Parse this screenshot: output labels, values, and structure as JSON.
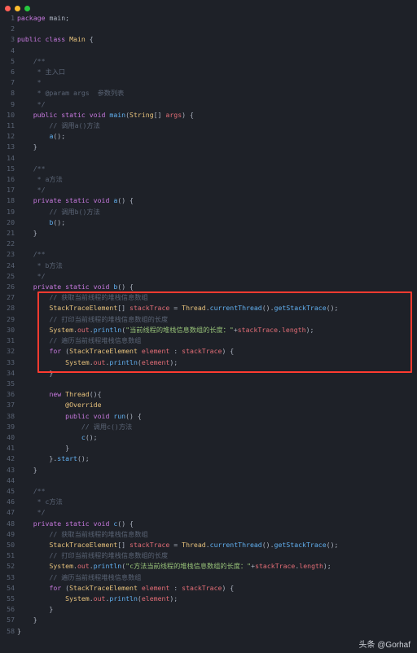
{
  "watermark": "头条 @Gorhaf",
  "lines": [
    {
      "n": 1,
      "tokens": [
        [
          "kw",
          "package"
        ],
        [
          "op",
          " main;"
        ]
      ]
    },
    {
      "n": 2,
      "tokens": []
    },
    {
      "n": 3,
      "tokens": [
        [
          "kw",
          "public class"
        ],
        [
          "op",
          " "
        ],
        [
          "type",
          "Main"
        ],
        [
          "op",
          " {"
        ]
      ]
    },
    {
      "n": 4,
      "tokens": []
    },
    {
      "n": 5,
      "tokens": [
        [
          "op",
          "    "
        ],
        [
          "cmt",
          "/**"
        ]
      ]
    },
    {
      "n": 6,
      "tokens": [
        [
          "op",
          "    "
        ],
        [
          "cmt",
          " * 主入口"
        ]
      ]
    },
    {
      "n": 7,
      "tokens": [
        [
          "op",
          "    "
        ],
        [
          "cmt",
          " *"
        ]
      ]
    },
    {
      "n": 8,
      "tokens": [
        [
          "op",
          "    "
        ],
        [
          "cmt",
          " * @param args  参数列表"
        ]
      ]
    },
    {
      "n": 9,
      "tokens": [
        [
          "op",
          "    "
        ],
        [
          "cmt",
          " */"
        ]
      ]
    },
    {
      "n": 10,
      "tokens": [
        [
          "op",
          "    "
        ],
        [
          "kw",
          "public static void"
        ],
        [
          "op",
          " "
        ],
        [
          "fn",
          "main"
        ],
        [
          "op",
          "("
        ],
        [
          "type",
          "String"
        ],
        [
          "op",
          "[] "
        ],
        [
          "id",
          "args"
        ],
        [
          "op",
          ") {"
        ]
      ]
    },
    {
      "n": 11,
      "tokens": [
        [
          "op",
          "        "
        ],
        [
          "cmt",
          "// 调用a()方法"
        ]
      ]
    },
    {
      "n": 12,
      "tokens": [
        [
          "op",
          "        "
        ],
        [
          "fn",
          "a"
        ],
        [
          "op",
          "();"
        ]
      ]
    },
    {
      "n": 13,
      "tokens": [
        [
          "op",
          "    }"
        ]
      ]
    },
    {
      "n": 14,
      "tokens": []
    },
    {
      "n": 15,
      "tokens": [
        [
          "op",
          "    "
        ],
        [
          "cmt",
          "/**"
        ]
      ]
    },
    {
      "n": 16,
      "tokens": [
        [
          "op",
          "    "
        ],
        [
          "cmt",
          " * a方法"
        ]
      ]
    },
    {
      "n": 17,
      "tokens": [
        [
          "op",
          "    "
        ],
        [
          "cmt",
          " */"
        ]
      ]
    },
    {
      "n": 18,
      "tokens": [
        [
          "op",
          "    "
        ],
        [
          "kw",
          "private static void"
        ],
        [
          "op",
          " "
        ],
        [
          "fn",
          "a"
        ],
        [
          "op",
          "() {"
        ]
      ]
    },
    {
      "n": 19,
      "tokens": [
        [
          "op",
          "        "
        ],
        [
          "cmt",
          "// 调用b()方法"
        ]
      ]
    },
    {
      "n": 20,
      "tokens": [
        [
          "op",
          "        "
        ],
        [
          "fn",
          "b"
        ],
        [
          "op",
          "();"
        ]
      ]
    },
    {
      "n": 21,
      "tokens": [
        [
          "op",
          "    }"
        ]
      ]
    },
    {
      "n": 22,
      "tokens": []
    },
    {
      "n": 23,
      "tokens": [
        [
          "op",
          "    "
        ],
        [
          "cmt",
          "/**"
        ]
      ]
    },
    {
      "n": 24,
      "tokens": [
        [
          "op",
          "    "
        ],
        [
          "cmt",
          " * b方法"
        ]
      ]
    },
    {
      "n": 25,
      "tokens": [
        [
          "op",
          "    "
        ],
        [
          "cmt",
          " */"
        ]
      ]
    },
    {
      "n": 26,
      "tokens": [
        [
          "op",
          "    "
        ],
        [
          "kw",
          "private static void"
        ],
        [
          "op",
          " "
        ],
        [
          "fn",
          "b"
        ],
        [
          "op",
          "() {"
        ]
      ]
    },
    {
      "n": 27,
      "tokens": [
        [
          "op",
          "        "
        ],
        [
          "cmt",
          "// 获取当前线程的堆栈信息数组"
        ]
      ]
    },
    {
      "n": 28,
      "tokens": [
        [
          "op",
          "        "
        ],
        [
          "type",
          "StackTraceElement"
        ],
        [
          "op",
          "[] "
        ],
        [
          "id",
          "stackTrace"
        ],
        [
          "op",
          " = "
        ],
        [
          "type",
          "Thread"
        ],
        [
          "op",
          "."
        ],
        [
          "fn",
          "currentThread"
        ],
        [
          "op",
          "()."
        ],
        [
          "fn",
          "getStackTrace"
        ],
        [
          "op",
          "();"
        ]
      ]
    },
    {
      "n": 29,
      "tokens": [
        [
          "op",
          "        "
        ],
        [
          "cmt",
          "// 打印当前线程的堆栈信息数组的长度"
        ]
      ]
    },
    {
      "n": 30,
      "tokens": [
        [
          "op",
          "        "
        ],
        [
          "type",
          "System"
        ],
        [
          "op",
          "."
        ],
        [
          "id",
          "out"
        ],
        [
          "op",
          "."
        ],
        [
          "fn",
          "println"
        ],
        [
          "op",
          "("
        ],
        [
          "str",
          "\"当前线程的堆栈信息数组的长度：\""
        ],
        [
          "op",
          "+"
        ],
        [
          "id",
          "stackTrace"
        ],
        [
          "op",
          "."
        ],
        [
          "id",
          "length"
        ],
        [
          "op",
          ");"
        ]
      ]
    },
    {
      "n": 31,
      "tokens": [
        [
          "op",
          "        "
        ],
        [
          "cmt",
          "// 遍历当前线程堆栈信息数组"
        ]
      ]
    },
    {
      "n": 32,
      "tokens": [
        [
          "op",
          "        "
        ],
        [
          "kw",
          "for"
        ],
        [
          "op",
          " ("
        ],
        [
          "type",
          "StackTraceElement"
        ],
        [
          "op",
          " "
        ],
        [
          "id",
          "element"
        ],
        [
          "op",
          " : "
        ],
        [
          "id",
          "stackTrace"
        ],
        [
          "op",
          ") {"
        ]
      ]
    },
    {
      "n": 33,
      "tokens": [
        [
          "op",
          "            "
        ],
        [
          "type",
          "System"
        ],
        [
          "op",
          "."
        ],
        [
          "id",
          "out"
        ],
        [
          "op",
          "."
        ],
        [
          "fn",
          "println"
        ],
        [
          "op",
          "("
        ],
        [
          "id",
          "element"
        ],
        [
          "op",
          ");"
        ]
      ]
    },
    {
      "n": 34,
      "tokens": [
        [
          "op",
          "        }"
        ]
      ]
    },
    {
      "n": 35,
      "tokens": []
    },
    {
      "n": 36,
      "tokens": [
        [
          "op",
          "        "
        ],
        [
          "kw",
          "new"
        ],
        [
          "op",
          " "
        ],
        [
          "type",
          "Thread"
        ],
        [
          "op",
          "(){"
        ]
      ]
    },
    {
      "n": 37,
      "tokens": [
        [
          "op",
          "            "
        ],
        [
          "ann",
          "@Override"
        ]
      ]
    },
    {
      "n": 38,
      "tokens": [
        [
          "op",
          "            "
        ],
        [
          "kw",
          "public void"
        ],
        [
          "op",
          " "
        ],
        [
          "fn",
          "run"
        ],
        [
          "op",
          "() {"
        ]
      ]
    },
    {
      "n": 39,
      "tokens": [
        [
          "op",
          "                "
        ],
        [
          "cmt",
          "// 调用c()方法"
        ]
      ]
    },
    {
      "n": 40,
      "tokens": [
        [
          "op",
          "                "
        ],
        [
          "fn",
          "c"
        ],
        [
          "op",
          "();"
        ]
      ]
    },
    {
      "n": 41,
      "tokens": [
        [
          "op",
          "            }"
        ]
      ]
    },
    {
      "n": 42,
      "tokens": [
        [
          "op",
          "        }."
        ],
        [
          "fn",
          "start"
        ],
        [
          "op",
          "();"
        ]
      ]
    },
    {
      "n": 43,
      "tokens": [
        [
          "op",
          "    }"
        ]
      ]
    },
    {
      "n": 44,
      "tokens": []
    },
    {
      "n": 45,
      "tokens": [
        [
          "op",
          "    "
        ],
        [
          "cmt",
          "/**"
        ]
      ]
    },
    {
      "n": 46,
      "tokens": [
        [
          "op",
          "    "
        ],
        [
          "cmt",
          " * c方法"
        ]
      ]
    },
    {
      "n": 47,
      "tokens": [
        [
          "op",
          "    "
        ],
        [
          "cmt",
          " */"
        ]
      ]
    },
    {
      "n": 48,
      "tokens": [
        [
          "op",
          "    "
        ],
        [
          "kw",
          "private static void"
        ],
        [
          "op",
          " "
        ],
        [
          "fn",
          "c"
        ],
        [
          "op",
          "() {"
        ]
      ]
    },
    {
      "n": 49,
      "tokens": [
        [
          "op",
          "        "
        ],
        [
          "cmt",
          "// 获取当前线程的堆栈信息数组"
        ]
      ]
    },
    {
      "n": 50,
      "tokens": [
        [
          "op",
          "        "
        ],
        [
          "type",
          "StackTraceElement"
        ],
        [
          "op",
          "[] "
        ],
        [
          "id",
          "stackTrace"
        ],
        [
          "op",
          " = "
        ],
        [
          "type",
          "Thread"
        ],
        [
          "op",
          "."
        ],
        [
          "fn",
          "currentThread"
        ],
        [
          "op",
          "()."
        ],
        [
          "fn",
          "getStackTrace"
        ],
        [
          "op",
          "();"
        ]
      ]
    },
    {
      "n": 51,
      "tokens": [
        [
          "op",
          "        "
        ],
        [
          "cmt",
          "// 打印当前线程的堆栈信息数组的长度"
        ]
      ]
    },
    {
      "n": 52,
      "tokens": [
        [
          "op",
          "        "
        ],
        [
          "type",
          "System"
        ],
        [
          "op",
          "."
        ],
        [
          "id",
          "out"
        ],
        [
          "op",
          "."
        ],
        [
          "fn",
          "println"
        ],
        [
          "op",
          "("
        ],
        [
          "str",
          "\"c方法当前线程的堆栈信息数组的长度：\""
        ],
        [
          "op",
          "+"
        ],
        [
          "id",
          "stackTrace"
        ],
        [
          "op",
          "."
        ],
        [
          "id",
          "length"
        ],
        [
          "op",
          ");"
        ]
      ]
    },
    {
      "n": 53,
      "tokens": [
        [
          "op",
          "        "
        ],
        [
          "cmt",
          "// 遍历当前线程堆栈信息数组"
        ]
      ]
    },
    {
      "n": 54,
      "tokens": [
        [
          "op",
          "        "
        ],
        [
          "kw",
          "for"
        ],
        [
          "op",
          " ("
        ],
        [
          "type",
          "StackTraceElement"
        ],
        [
          "op",
          " "
        ],
        [
          "id",
          "element"
        ],
        [
          "op",
          " : "
        ],
        [
          "id",
          "stackTrace"
        ],
        [
          "op",
          ") {"
        ]
      ]
    },
    {
      "n": 55,
      "tokens": [
        [
          "op",
          "            "
        ],
        [
          "type",
          "System"
        ],
        [
          "op",
          "."
        ],
        [
          "id",
          "out"
        ],
        [
          "op",
          "."
        ],
        [
          "fn",
          "println"
        ],
        [
          "op",
          "("
        ],
        [
          "id",
          "element"
        ],
        [
          "op",
          ");"
        ]
      ]
    },
    {
      "n": 56,
      "tokens": [
        [
          "op",
          "        }"
        ]
      ]
    },
    {
      "n": 57,
      "tokens": [
        [
          "op",
          "    }"
        ]
      ]
    },
    {
      "n": 58,
      "tokens": [
        [
          "op",
          "}"
        ]
      ]
    }
  ]
}
